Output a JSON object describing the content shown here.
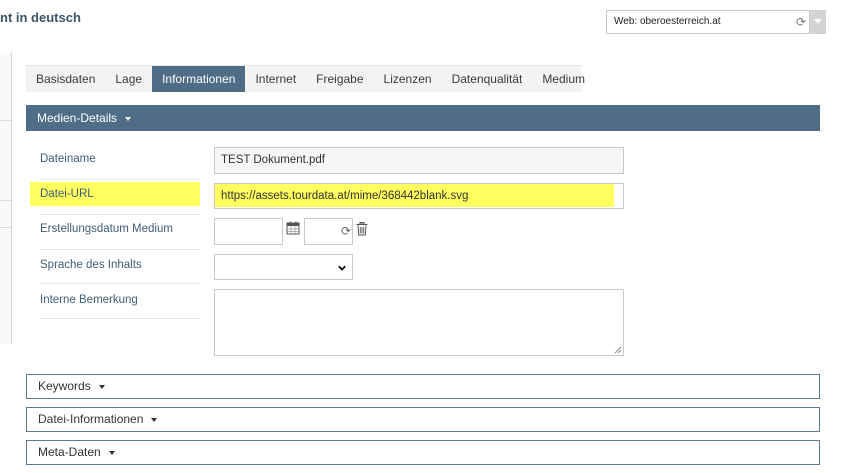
{
  "page": {
    "title": "nt in deutsch"
  },
  "web_selector": {
    "value": "Web: oberoesterreich.at"
  },
  "tabs": [
    {
      "label": "Basisdaten",
      "active": false
    },
    {
      "label": "Lage",
      "active": false
    },
    {
      "label": "Informationen",
      "active": true
    },
    {
      "label": "Internet",
      "active": false
    },
    {
      "label": "Freigabe",
      "active": false
    },
    {
      "label": "Lizenzen",
      "active": false
    },
    {
      "label": "Datenqualität",
      "active": false
    },
    {
      "label": "Medium",
      "active": false
    }
  ],
  "sections": {
    "medien_details": {
      "label": "Medien-Details"
    },
    "keywords": {
      "label": "Keywords"
    },
    "datei_informationen": {
      "label": "Datei-Informationen"
    },
    "meta_daten": {
      "label": "Meta-Daten"
    }
  },
  "fields": {
    "dateiname": {
      "label": "Dateiname",
      "value": "TEST Dokument.pdf"
    },
    "datei_url": {
      "label": "Datei-URL",
      "value": "https://assets.tourdata.at/mime/368442blank.svg",
      "highlighted": true
    },
    "erstellungsdatum": {
      "label": "Erstellungsdatum Medium",
      "date_value": "",
      "time_value": ""
    },
    "sprache": {
      "label": "Sprache des Inhalts",
      "value": ""
    },
    "bemerkung": {
      "label": "Interne Bemerkung",
      "value": ""
    }
  },
  "icons": {
    "date_picker": "calendar-icon",
    "reset": "refresh-icon",
    "clear": "trash-icon",
    "web_reset": "refresh-icon",
    "dropdown": "chevron-down-icon"
  },
  "colors": {
    "accent": "#4f6d86",
    "label": "#3e5e78",
    "highlight": "#ffff33",
    "tab_bar": "#f3f3f3"
  }
}
